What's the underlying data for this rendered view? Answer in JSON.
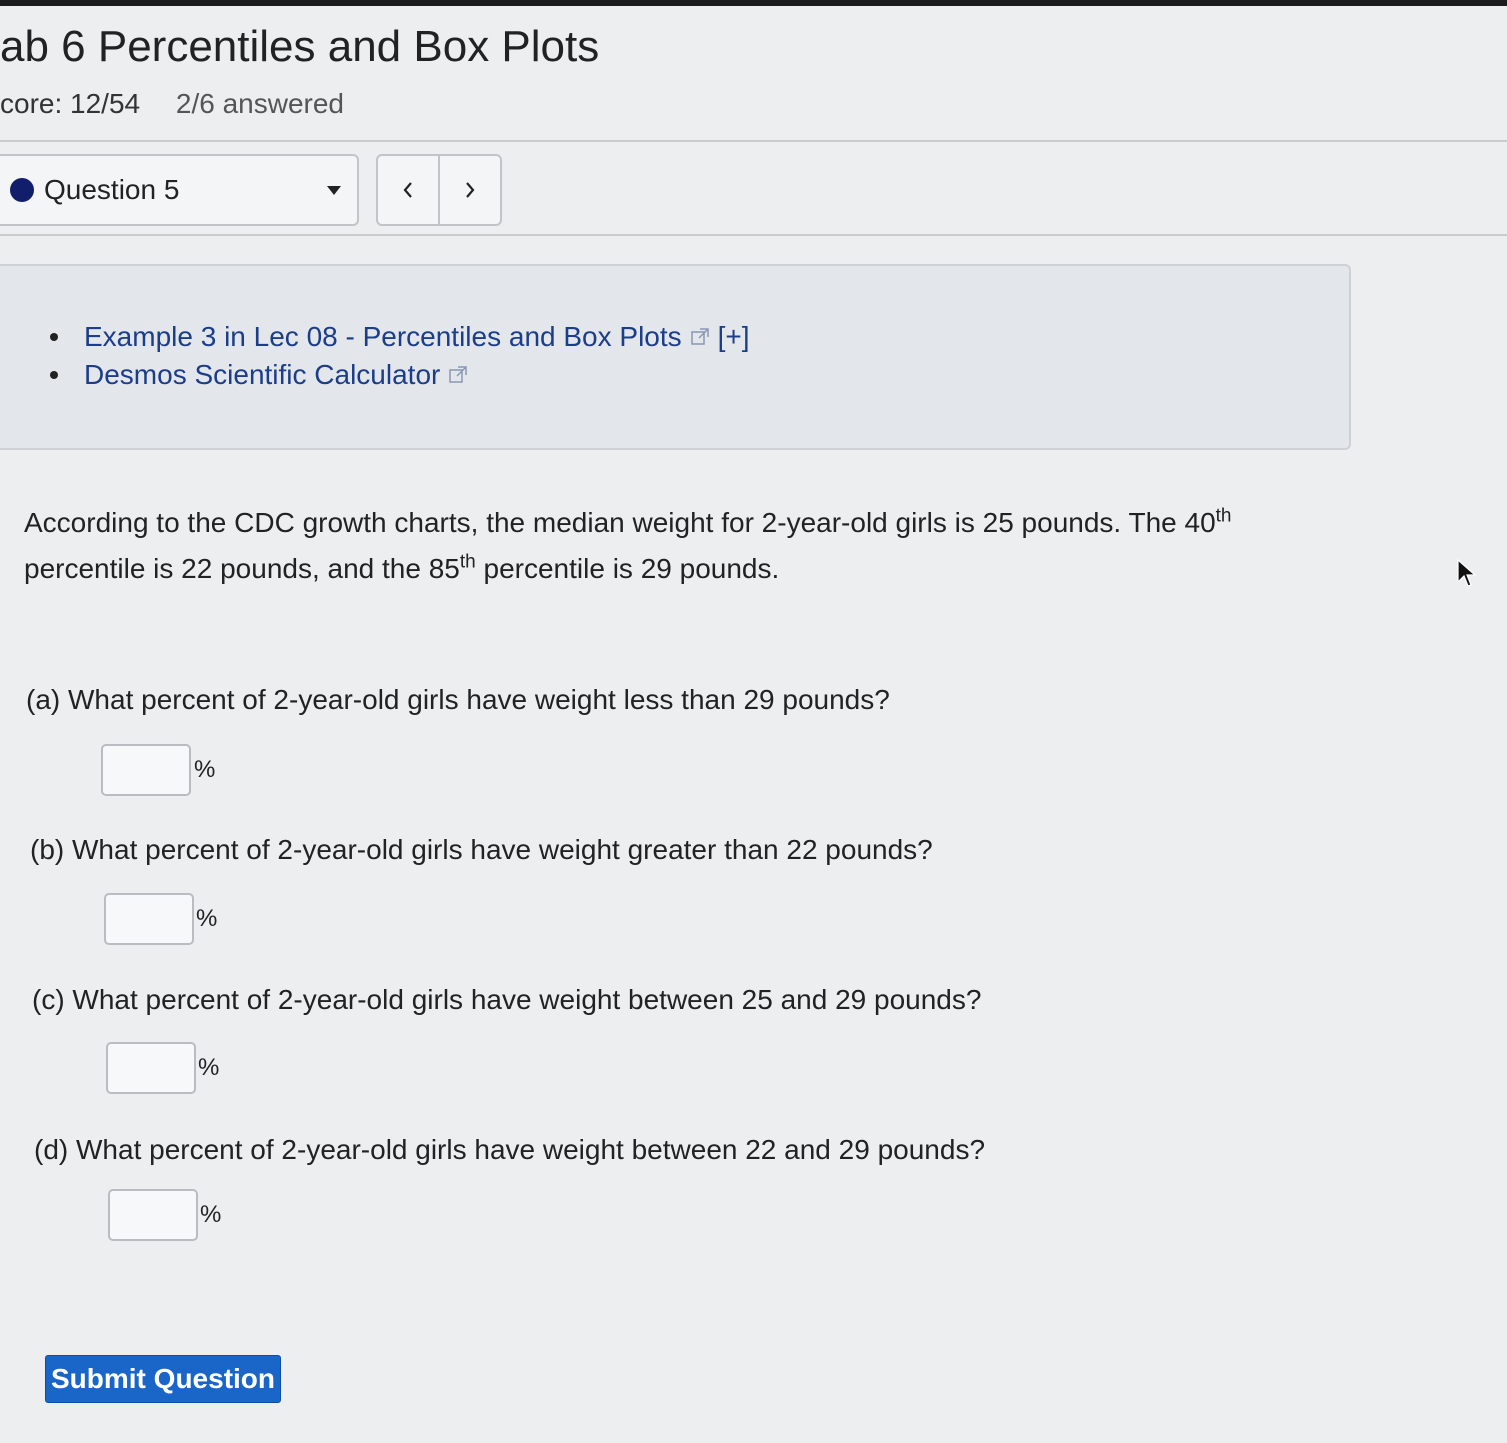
{
  "page": {
    "title": "ab 6 Percentiles and Box Plots",
    "score": "core: 12/54",
    "answered": "2/6 answered"
  },
  "question_nav": {
    "selected": "Question 5",
    "status_color": "#101e6b",
    "prev_icon": "chevron-left-icon",
    "next_icon": "chevron-right-icon"
  },
  "help": {
    "items": [
      {
        "label": "Example 3 in Lec 08 - Percentiles and Box Plots",
        "external_icon": "external-link-icon",
        "expand": "[+]"
      },
      {
        "label": "Desmos Scientific Calculator",
        "external_icon": "external-link-icon"
      }
    ]
  },
  "stem": {
    "part1": "According to the CDC growth charts, the median weight for 2-year-old girls is 25 pounds. The 40",
    "sup1": "th",
    "part2": " percentile is 22 pounds, and the 85",
    "sup2": "th",
    "part3": " percentile is 29 pounds."
  },
  "parts": [
    {
      "question": "(a) What percent of 2-year-old girls have weight less than 29 pounds?",
      "value": "",
      "unit": "%"
    },
    {
      "question": "(b) What percent of 2-year-old girls have weight greater than 22 pounds?",
      "value": "",
      "unit": "%"
    },
    {
      "question": "(c) What percent of 2-year-old girls have weight between 25 and 29 pounds?",
      "value": "",
      "unit": "%"
    },
    {
      "question": "(d) What percent of 2-year-old girls have weight between 22 and 29 pounds?",
      "value": "",
      "unit": "%"
    }
  ],
  "submit": {
    "label": "Submit Question",
    "color": "#1a66c8"
  }
}
